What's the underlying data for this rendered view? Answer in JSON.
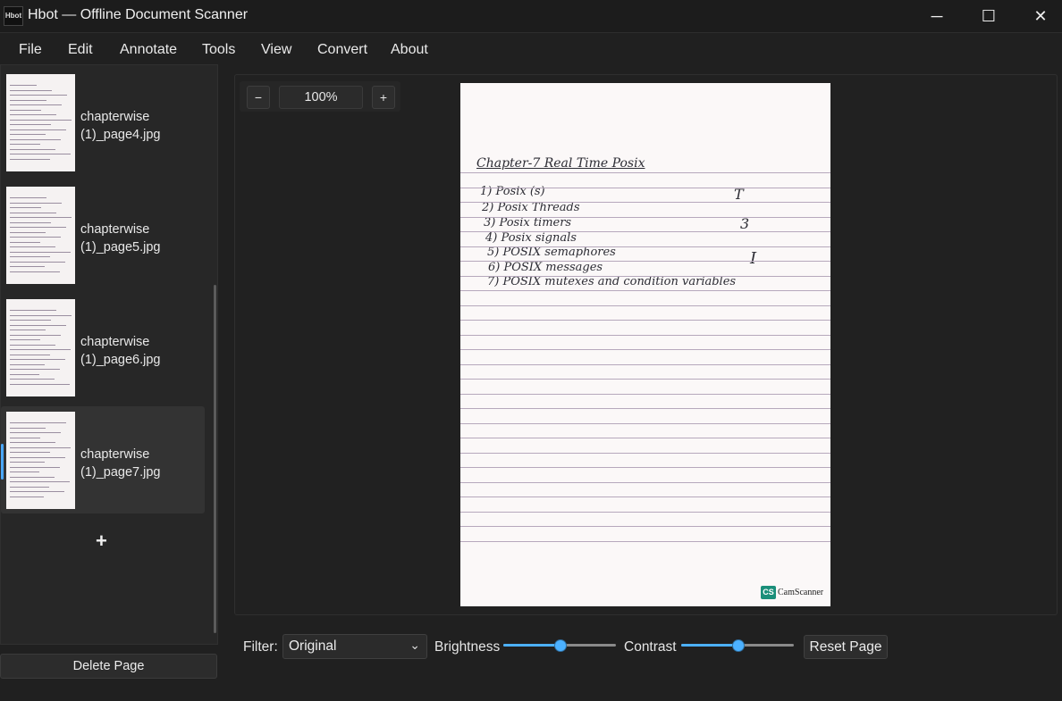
{
  "window": {
    "icon_text": "Hbot",
    "title": "Hbot — Offline Document Scanner",
    "controls": {
      "minimize": "─",
      "maximize": "☐",
      "close": "✕"
    }
  },
  "menu": [
    "File",
    "Edit",
    "Annotate",
    "Tools",
    "View",
    "Convert",
    "About"
  ],
  "pages": [
    {
      "name": "chapterwise (1)_page4.jpg"
    },
    {
      "name": "chapterwise (1)_page5.jpg"
    },
    {
      "name": "chapterwise (1)_page6.jpg"
    },
    {
      "name": "chapterwise (1)_page7.jpg"
    }
  ],
  "selected_page_index": 3,
  "add_page_label": "+",
  "delete_page_label": "Delete Page",
  "zoom": {
    "minus": "−",
    "value": "100%",
    "plus": "+"
  },
  "document": {
    "heading": "Chapter-7  Real Time Posix",
    "lines": [
      "1) Posix (s)",
      "2) Posix Threads",
      "3) Posix timers",
      "4) Posix signals",
      "5) POSIX semaphores",
      "6) POSIX messages",
      "7) POSIX mutexes and condition variables"
    ],
    "margin_marks": [
      "T",
      "3",
      "I"
    ],
    "watermark_badge": "CS",
    "watermark_text": "CamScanner"
  },
  "controls": {
    "filter_label": "Filter:",
    "filter_value": "Original",
    "brightness_label": "Brightness",
    "brightness_level": 0.5,
    "contrast_label": "Contrast",
    "contrast_level": 0.5,
    "reset_label": "Reset Page"
  },
  "colors": {
    "accent": "#4cb1ff",
    "background": "#202020",
    "panel": "#272727"
  }
}
